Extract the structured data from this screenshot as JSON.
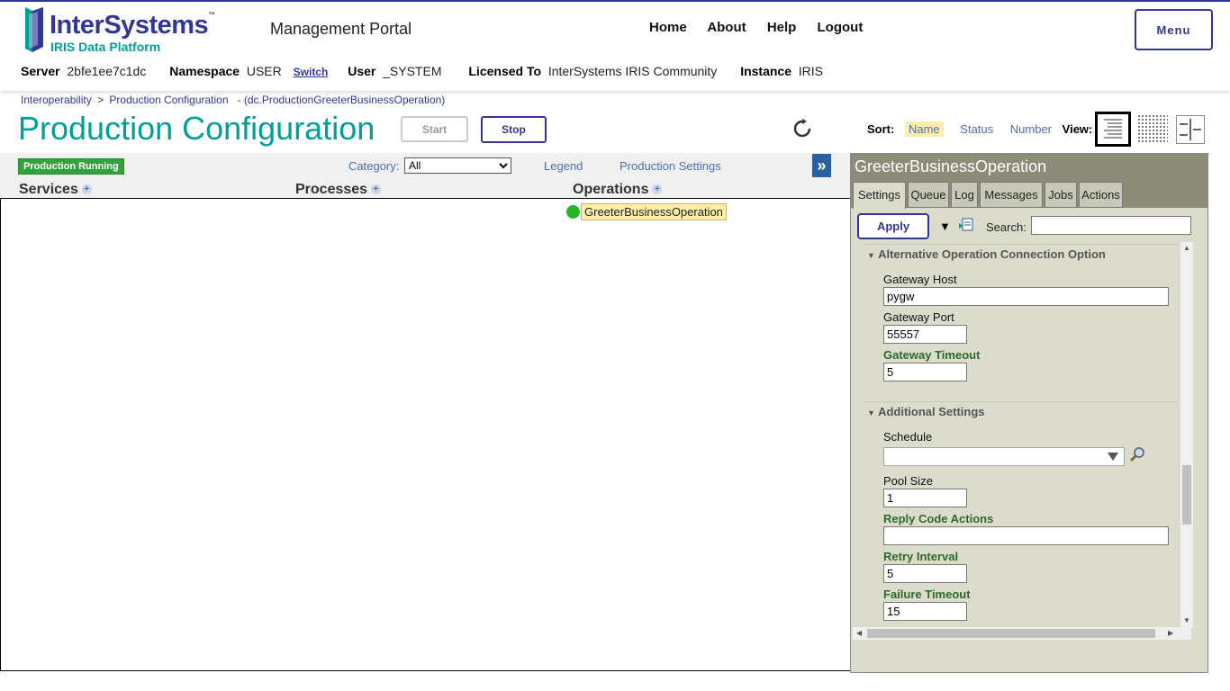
{
  "header": {
    "logo_word": "InterSystems",
    "logo_sub": "IRIS Data Platform",
    "portal_title": "Management Portal",
    "nav": [
      "Home",
      "About",
      "Help",
      "Logout"
    ],
    "menu_label": "Menu"
  },
  "info": {
    "server_label": "Server",
    "server_value": "2bfe1ee7c1dc",
    "namespace_label": "Namespace",
    "namespace_value": "USER",
    "switch_label": "Switch",
    "user_label": "User",
    "user_value": "_SYSTEM",
    "licensed_label": "Licensed To",
    "licensed_value": "InterSystems IRIS Community",
    "instance_label": "Instance",
    "instance_value": "IRIS"
  },
  "breadcrumb": {
    "items": [
      "Interoperability",
      "Production Configuration"
    ],
    "separator": ">",
    "suffix": "- (dc.ProductionGreeterBusinessOperation)"
  },
  "page": {
    "title": "Production Configuration",
    "start_label": "Start",
    "stop_label": "Stop"
  },
  "sort": {
    "label": "Sort:",
    "options": [
      "Name",
      "Status",
      "Number"
    ],
    "selected": "Name",
    "view_label": "View:"
  },
  "diagram": {
    "status_badge": "Production Running",
    "category_label": "Category:",
    "category_value": "All",
    "legend_link": "Legend",
    "settings_link": "Production Settings",
    "expand_glyph": "»",
    "columns": [
      "Services",
      "Processes",
      "Operations"
    ],
    "operation_item": "GreeterBusinessOperation",
    "status_color": "#22b822"
  },
  "panel": {
    "title": "GreeterBusinessOperation",
    "tabs": [
      "Settings",
      "Queue",
      "Log",
      "Messages",
      "Jobs",
      "Actions"
    ],
    "active_tab": "Settings",
    "apply_label": "Apply",
    "search_label": "Search:",
    "search_value": "",
    "sections": {
      "alt_conn": "Alternative Operation Connection Option",
      "additional": "Additional Settings"
    },
    "fields": {
      "gateway_host_label": "Gateway Host",
      "gateway_host_value": "pygw",
      "gateway_port_label": "Gateway Port",
      "gateway_port_value": "55557",
      "gateway_timeout_label": "Gateway Timeout",
      "gateway_timeout_value": "5",
      "schedule_label": "Schedule",
      "schedule_value": "",
      "pool_size_label": "Pool Size",
      "pool_size_value": "1",
      "reply_code_label": "Reply Code Actions",
      "reply_code_value": "",
      "retry_interval_label": "Retry Interval",
      "retry_interval_value": "5",
      "failure_timeout_label": "Failure Timeout",
      "failure_timeout_value": "15"
    }
  },
  "colors": {
    "brand_blue": "#333695",
    "brand_teal": "#00a09a",
    "running_green": "#33a23e",
    "item_yellow": "#ffeeaa"
  }
}
